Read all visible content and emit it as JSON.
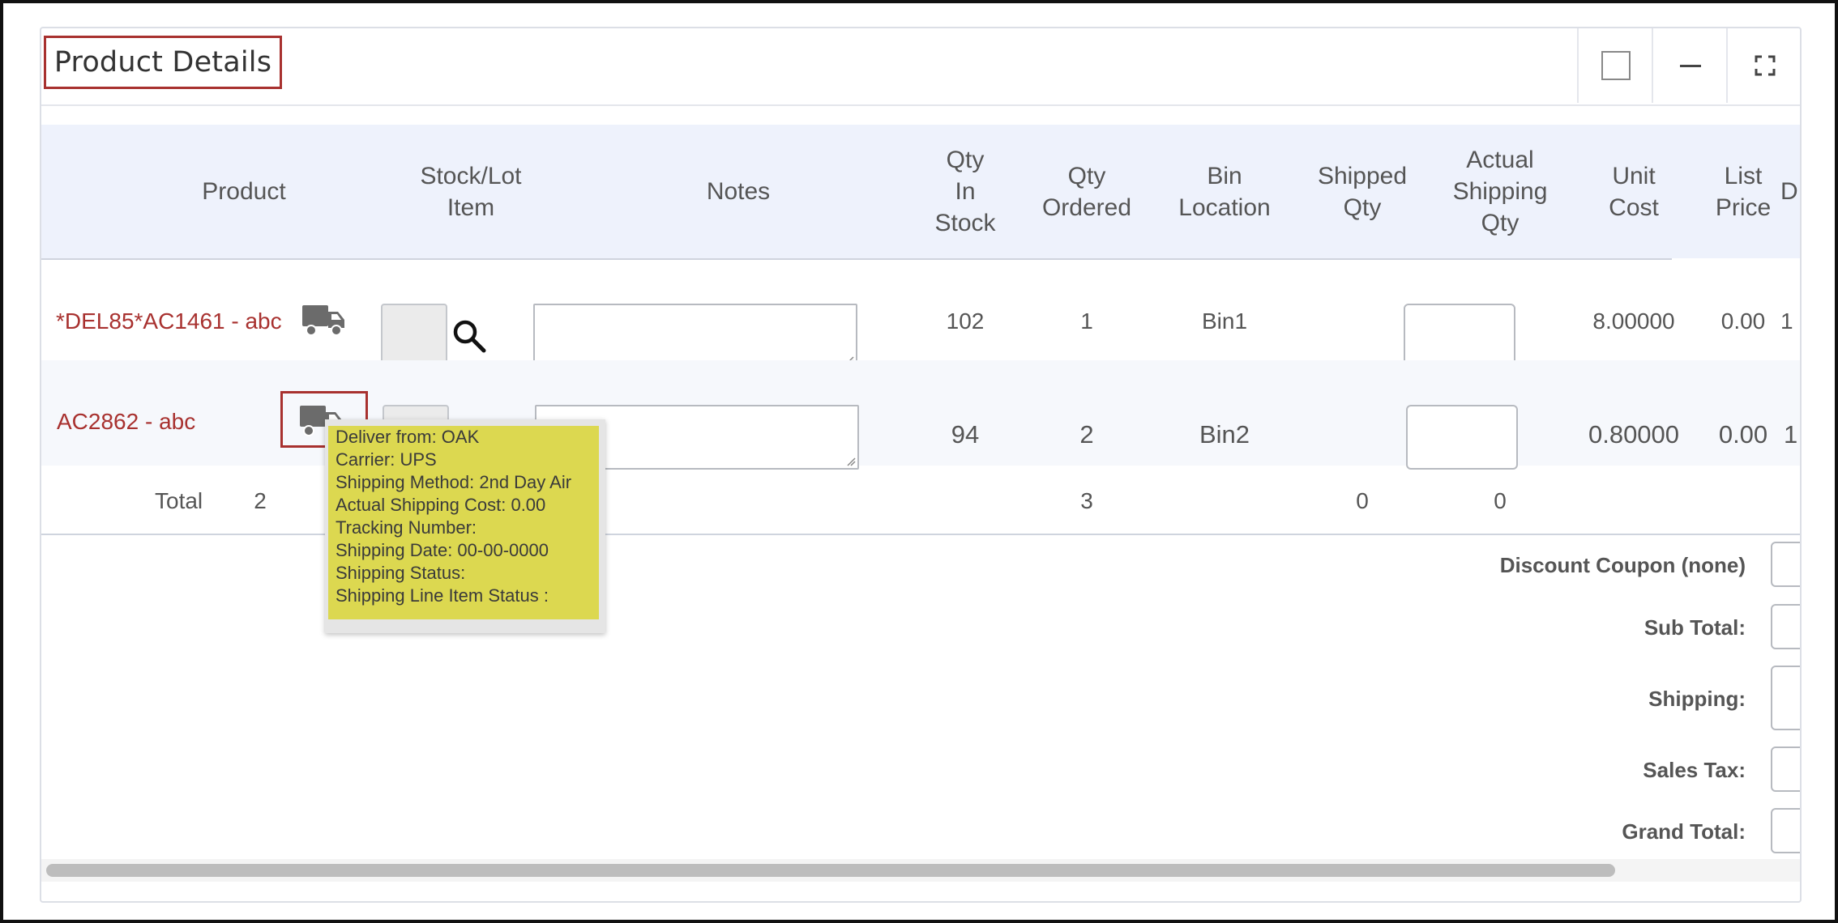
{
  "panel": {
    "title": "Product Details"
  },
  "table": {
    "headers": {
      "product": "Product",
      "stock_lot": "Stock/Lot\nItem",
      "notes": "Notes",
      "qty_in_stock": "Qty\nIn\nStock",
      "qty_ordered": "Qty\nOrdered",
      "bin_location": "Bin\nLocation",
      "shipped_qty": "Shipped\nQty",
      "actual_shipping_qty": "Actual\nShipping\nQty",
      "unit_cost": "Unit\nCost",
      "list_price": "List\nPrice",
      "clipped": "D"
    },
    "rows": [
      {
        "product": "*DEL85*AC1461 - abc",
        "qty_in_stock": "102",
        "qty_ordered": "1",
        "bin_location": "Bin1",
        "unit_cost": "8.00000",
        "list_price": "0.00",
        "clipped": "1"
      },
      {
        "product": "AC2862 - abc",
        "qty_in_stock": "94",
        "qty_ordered": "2",
        "bin_location": "Bin2",
        "unit_cost": "0.80000",
        "list_price": "0.00",
        "clipped": "1"
      }
    ],
    "total": {
      "label": "Total",
      "count": "2",
      "qty_ordered": "3",
      "shipped_qty": "0",
      "actual_shipping_qty": "0"
    }
  },
  "summary": {
    "discount_label": "Discount Coupon (none)",
    "subtotal_label": "Sub Total:",
    "shipping_label": "Shipping:",
    "sales_tax_label": "Sales Tax:",
    "grand_total_label": "Grand Total:"
  },
  "tooltip": {
    "lines": [
      "Deliver from: OAK",
      "Carrier: UPS",
      "Shipping Method: 2nd Day Air",
      "Actual Shipping Cost: 0.00",
      "Tracking Number:",
      "Shipping Date: 00-00-0000",
      "Shipping Status:",
      "Shipping Line Item Status :"
    ]
  },
  "icons": {
    "truck": "truck-icon",
    "search": "search-icon",
    "minimize": "minimize-icon",
    "expand": "expand-icon"
  },
  "colors": {
    "accent": "#a8312f",
    "header_bg": "#eef2fc",
    "tooltip_bg": "#dcd850"
  }
}
